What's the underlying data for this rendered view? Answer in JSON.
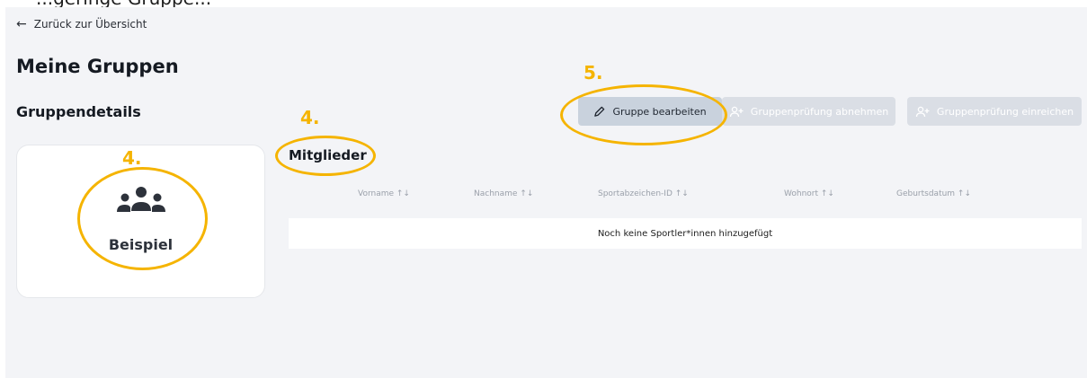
{
  "header_cut_text": "...geringe Gruppe...",
  "nav": {
    "back_label": "Zurück zur Übersicht"
  },
  "page": {
    "title": "Meine Gruppen",
    "section_title": "Gruppendetails"
  },
  "group_card": {
    "name": "Beispiel",
    "icon": "group-icon"
  },
  "members": {
    "title": "Mitglieder"
  },
  "buttons": {
    "edit": "Gruppe bearbeiten",
    "take_exam": "Gruppenprüfung abnehmen",
    "submit_exam": "Gruppenprüfung einreichen"
  },
  "table": {
    "columns": [
      "Vorname ↑↓",
      "Nachname ↑↓",
      "Sportabzeichen-ID ↑↓",
      "Wohnort ↑↓",
      "Geburtsdatum ↑↓"
    ],
    "empty_text": "Noch keine Sportler*innen hinzugefügt"
  },
  "annotations": [
    "4.",
    "4.",
    "5."
  ],
  "colors": {
    "annotation": "#f5b400",
    "background": "#f3f4f7",
    "edit_button": "#c9d2dd",
    "disabled_button": "#dadee5"
  }
}
